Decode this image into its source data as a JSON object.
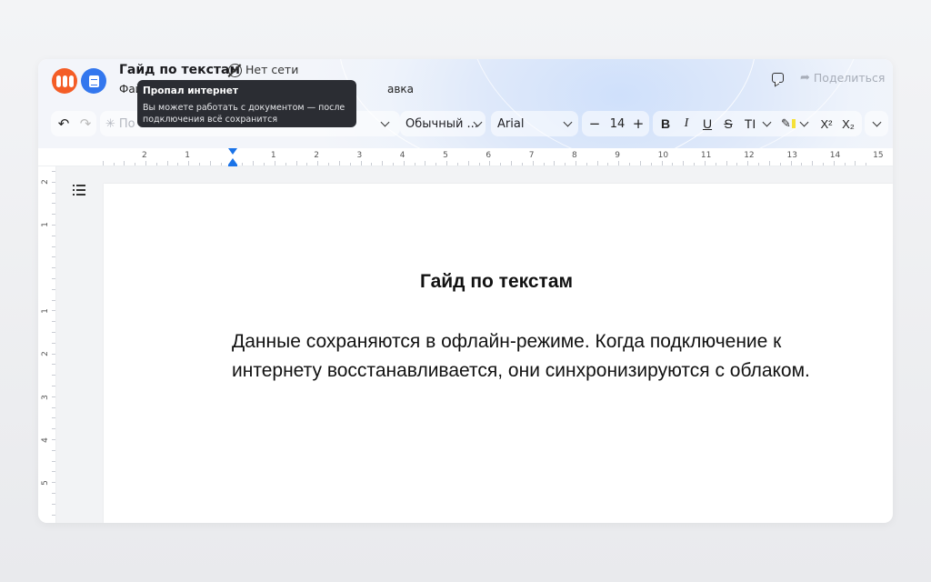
{
  "header": {
    "doc_title": "Гайд по текстам",
    "offline_label": "Нет сети",
    "menu_fragment_left": "Фай",
    "menu_fragment_right": "авка",
    "share_label": "Поделиться"
  },
  "tooltip": {
    "title": "Пропал интернет",
    "text_line1": "Вы можете работать с документом — после",
    "text_line2": "подключения всё сохранится"
  },
  "toolbar": {
    "style_fragment": "По",
    "paragraph_style": "Обычный ...",
    "font_family": "Arial",
    "font_size": "14",
    "minus": "−",
    "plus": "+",
    "bold": "B",
    "italic": "I",
    "underline": "U",
    "strike": "S",
    "text_color": "TI",
    "superscript": "X²",
    "subscript": "X₂"
  },
  "ruler": {
    "h_labels": [
      "2",
      "1",
      "1",
      "2",
      "3",
      "4",
      "5",
      "6",
      "7",
      "8",
      "9",
      "10",
      "11",
      "12",
      "13",
      "14",
      "15"
    ],
    "v_labels": [
      "2",
      "1",
      "1",
      "2",
      "3",
      "4",
      "5"
    ]
  },
  "document": {
    "heading": "Гайд по текстам",
    "paragraph_line1": "Данные сохраняются в офлайн-режиме. Когда подключение к",
    "paragraph_line2": "интернету восстанавливается, они синхронизируются с облаком."
  },
  "icons": {
    "undo": "undo-icon",
    "redo": "redo-icon",
    "offline": "cloud-off-icon",
    "comment": "comment-icon",
    "share": "share-icon",
    "outline": "list-icon",
    "highlight": "highlighter-icon"
  },
  "colors": {
    "accent": "#1a73e8",
    "tooltip_bg": "#2b2d33",
    "logo_orange": "#f45d26",
    "logo_blue": "#3377ee"
  }
}
